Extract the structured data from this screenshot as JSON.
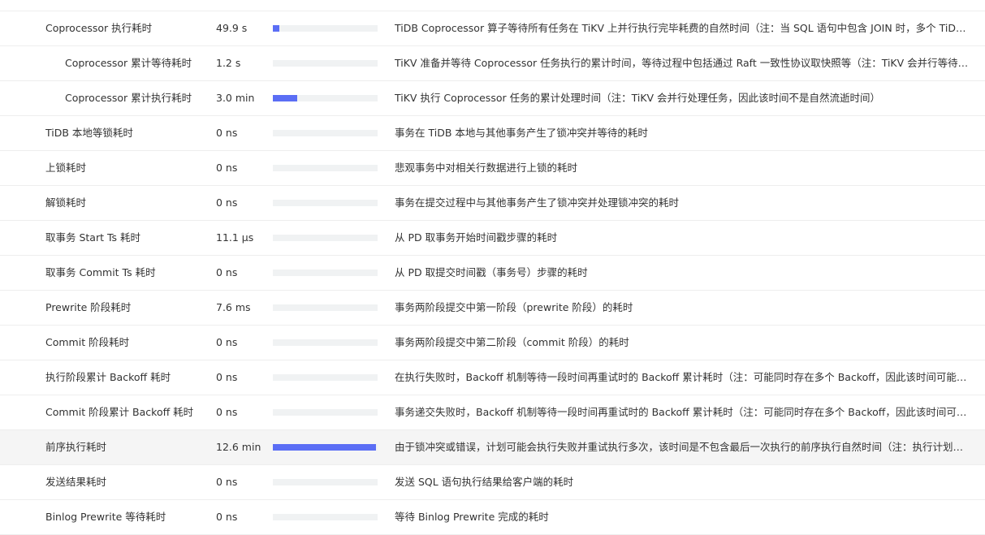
{
  "rows": [
    {
      "name": "",
      "value": "",
      "fill": 0,
      "desc": "",
      "indent": false
    },
    {
      "name": "Coprocessor 执行耗时",
      "value": "49.9 s",
      "fill": 0.06,
      "desc": "TiDB Coprocessor 算子等待所有任务在 TiKV 上并行执行完毕耗费的自然时间（注：当 SQL 语句中包含 JOIN 时，多个 TiDB Coprocessor 算子可能会并行执行）",
      "indent": false
    },
    {
      "name": "Coprocessor 累计等待耗时",
      "value": "1.2 s",
      "fill": 0.0,
      "desc": "TiKV 准备并等待 Coprocessor 任务执行的累计时间，等待过程中包括通过 Raft 一致性协议取快照等（注：TiKV 会并行等待任务）",
      "indent": true
    },
    {
      "name": "Coprocessor 累计执行耗时",
      "value": "3.0 min",
      "fill": 0.235,
      "desc": "TiKV 执行 Coprocessor 任务的累计处理时间（注：TiKV 会并行处理任务，因此该时间不是自然流逝时间）",
      "indent": true
    },
    {
      "name": "TiDB 本地等锁耗时",
      "value": "0 ns",
      "fill": 0,
      "desc": "事务在 TiDB 本地与其他事务产生了锁冲突并等待的耗时",
      "indent": false
    },
    {
      "name": "上锁耗时",
      "value": "0 ns",
      "fill": 0,
      "desc": "悲观事务中对相关行数据进行上锁的耗时",
      "indent": false
    },
    {
      "name": "解锁耗时",
      "value": "0 ns",
      "fill": 0,
      "desc": "事务在提交过程中与其他事务产生了锁冲突并处理锁冲突的耗时",
      "indent": false
    },
    {
      "name": "取事务 Start Ts 耗时",
      "value": "11.1 μs",
      "fill": 0,
      "desc": "从 PD 取事务开始时间戳步骤的耗时",
      "indent": false
    },
    {
      "name": "取事务 Commit Ts 耗时",
      "value": "0 ns",
      "fill": 0,
      "desc": "从 PD 取提交时间戳（事务号）步骤的耗时",
      "indent": false
    },
    {
      "name": "Prewrite 阶段耗时",
      "value": "7.6 ms",
      "fill": 0,
      "desc": "事务两阶段提交中第一阶段（prewrite 阶段）的耗时",
      "indent": false
    },
    {
      "name": "Commit 阶段耗时",
      "value": "0 ns",
      "fill": 0,
      "desc": "事务两阶段提交中第二阶段（commit 阶段）的耗时",
      "indent": false
    },
    {
      "name": "执行阶段累计 Backoff 耗时",
      "value": "0 ns",
      "fill": 0,
      "desc": "在执行失败时，Backoff 机制等待一段时间再重试时的 Backoff 累计耗时（注：可能同时存在多个 Backoff，因此该时间可能不是自然流逝时间）",
      "indent": false
    },
    {
      "name": "Commit 阶段累计 Backoff 耗时",
      "value": "0 ns",
      "fill": 0,
      "desc": "事务递交失败时，Backoff 机制等待一段时间再重试时的 Backoff 累计耗时（注：可能同时存在多个 Backoff，因此该时间可能不是自然流逝时间）",
      "indent": false
    },
    {
      "name": "前序执行耗时",
      "value": "12.6 min",
      "fill": 0.985,
      "desc": "由于锁冲突或错误，计划可能会执行失败并重试执行多次，该时间是不包含最后一次执行的前序执行自然时间（注：执行计划可能并行执行）",
      "indent": false,
      "highlight": true
    },
    {
      "name": "发送结果耗时",
      "value": "0 ns",
      "fill": 0,
      "desc": "发送 SQL 语句执行结果给客户端的耗时",
      "indent": false
    },
    {
      "name": "Binlog Prewrite 等待耗时",
      "value": "0 ns",
      "fill": 0,
      "desc": "等待 Binlog Prewrite 完成的耗时",
      "indent": false
    }
  ],
  "colors": {
    "bar_fill": "#5b6ef5",
    "bar_track": "#f0f2f3",
    "highlight_row": "#f5f5f5"
  }
}
